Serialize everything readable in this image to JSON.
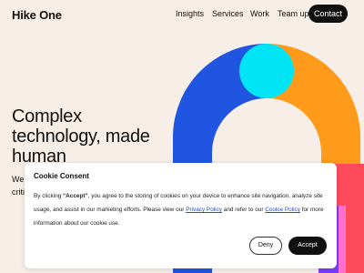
{
  "header": {
    "logo": "Hike One",
    "nav": [
      "Insights",
      "Services",
      "Work",
      "Team up"
    ],
    "contact_label": "Contact"
  },
  "hero": {
    "headline_lines": [
      "Complex",
      "technology, made",
      "human"
    ],
    "subtext_lines": [
      "We",
      "criti"
    ]
  },
  "cookie": {
    "title": "Cookie Consent",
    "body_prefix": "By clicking ",
    "body_bold": "“Accept”",
    "body_mid": ", you agree to the storing of cookies on your device to enhance site navigation, analyze site usage, and assist in our marketing efforts. Please view our ",
    "privacy_link": "Privacy Policy",
    "body_mid2": " and refer to our ",
    "cookie_link": "Cookie Policy",
    "body_suffix": " for more information about our cookie use.",
    "deny_label": "Deny",
    "accept_label": "Accept"
  },
  "colors": {
    "background": "#f7efe7",
    "blue": "#1f55e0",
    "orange": "#ff9a1a",
    "cyan": "#00e5f5",
    "red": "#ff4a5c",
    "pink": "#ff6fd0",
    "purple": "#7b3cff"
  }
}
